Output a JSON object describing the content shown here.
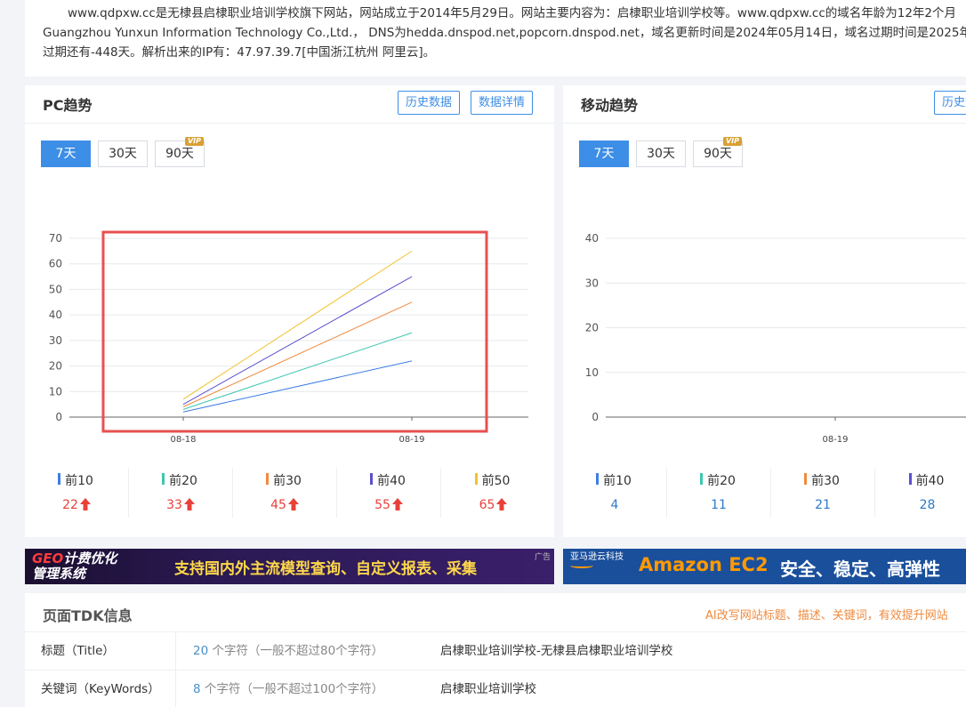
{
  "intro": {
    "line1": "www.qdpxw.cc是无棣县启棣职业培训学校旗下网站，网站成立于2014年5月29日。网站主要内容为：启棣职业培训学校等。www.qdpxw.cc的域名年龄为12年2个月",
    "line2": "Guangzhou Yunxun Information Technology Co.,Ltd.， DNS为hedda.dnspod.net,popcorn.dnspod.net，域名更新时间是2024年05月14日，域名过期时间是2025年",
    "line3": "过期还有-448天。解析出来的IP有：47.97.39.7[中国浙江杭州 阿里云]。"
  },
  "pc": {
    "title": "PC趋势",
    "btn_history": "历史数据",
    "btn_detail": "数据详情",
    "ranges": [
      "7天",
      "30天",
      "90天"
    ],
    "vip": "VIP",
    "stats": [
      {
        "label": "前10",
        "value": "22",
        "color": "#3d7ee6"
      },
      {
        "label": "前20",
        "value": "33",
        "color": "#3cc7b2"
      },
      {
        "label": "前30",
        "value": "45",
        "color": "#f08a3e"
      },
      {
        "label": "前40",
        "value": "55",
        "color": "#5a4fd1"
      },
      {
        "label": "前50",
        "value": "65",
        "color": "#f2c12e"
      }
    ]
  },
  "mobile": {
    "title": "移动趋势",
    "btn_history": "历史数据",
    "ranges": [
      "7天",
      "30天",
      "90天"
    ],
    "vip": "VIP",
    "stats": [
      {
        "label": "前10",
        "value": "4",
        "color": "#3d7ee6"
      },
      {
        "label": "前20",
        "value": "11",
        "color": "#3cc7b2"
      },
      {
        "label": "前30",
        "value": "21",
        "color": "#f08a3e"
      },
      {
        "label": "前40",
        "value": "28",
        "color": "#5a4fd1"
      }
    ]
  },
  "chart_data": [
    {
      "type": "line",
      "x": [
        "08-18",
        "08-19"
      ],
      "ylim": [
        0,
        70
      ],
      "yticks": [
        0,
        10,
        20,
        30,
        40,
        50,
        60,
        70
      ],
      "grid": true,
      "series": [
        {
          "name": "前10",
          "values": [
            2,
            22
          ],
          "color": "#3d7ee6"
        },
        {
          "name": "前20",
          "values": [
            3,
            33
          ],
          "color": "#3cc7b2"
        },
        {
          "name": "前30",
          "values": [
            4,
            45
          ],
          "color": "#f08a3e"
        },
        {
          "name": "前40",
          "values": [
            5,
            55
          ],
          "color": "#5a4fd1"
        },
        {
          "name": "前50",
          "values": [
            7,
            65
          ],
          "color": "#f2c12e"
        }
      ],
      "highlight_box_color": "#e85050"
    },
    {
      "type": "line",
      "x": [
        "08-19"
      ],
      "ylim": [
        0,
        40
      ],
      "yticks": [
        0,
        10,
        20,
        30,
        40
      ],
      "grid": true,
      "series": []
    }
  ],
  "banners": {
    "left_logo_geo": "GEO",
    "left_logo_rest": "计费优化",
    "left_logo_line2": "管理系统",
    "left_text": "支持国内外主流模型查询、自定义报表、采集",
    "ad_tag": "广告",
    "right_logo": "亚马逊云科技",
    "right_product": "Amazon EC2",
    "right_slogan": "安全、稳定、高弹性"
  },
  "tdk": {
    "title": "页面TDK信息",
    "ai_link": "AI改写网站标题、描述、关键词，有效提升网站",
    "rows": [
      {
        "label": "标题（Title）",
        "count": "20",
        "count_text": " 个字符（一般不超过80个字符）",
        "value": "启棣职业培训学校-无棣县启棣职业培训学校"
      },
      {
        "label": "关键词（KeyWords）",
        "count": "8",
        "count_text": " 个字符（一般不超过100个字符）",
        "value": "启棣职业培训学校"
      }
    ]
  }
}
